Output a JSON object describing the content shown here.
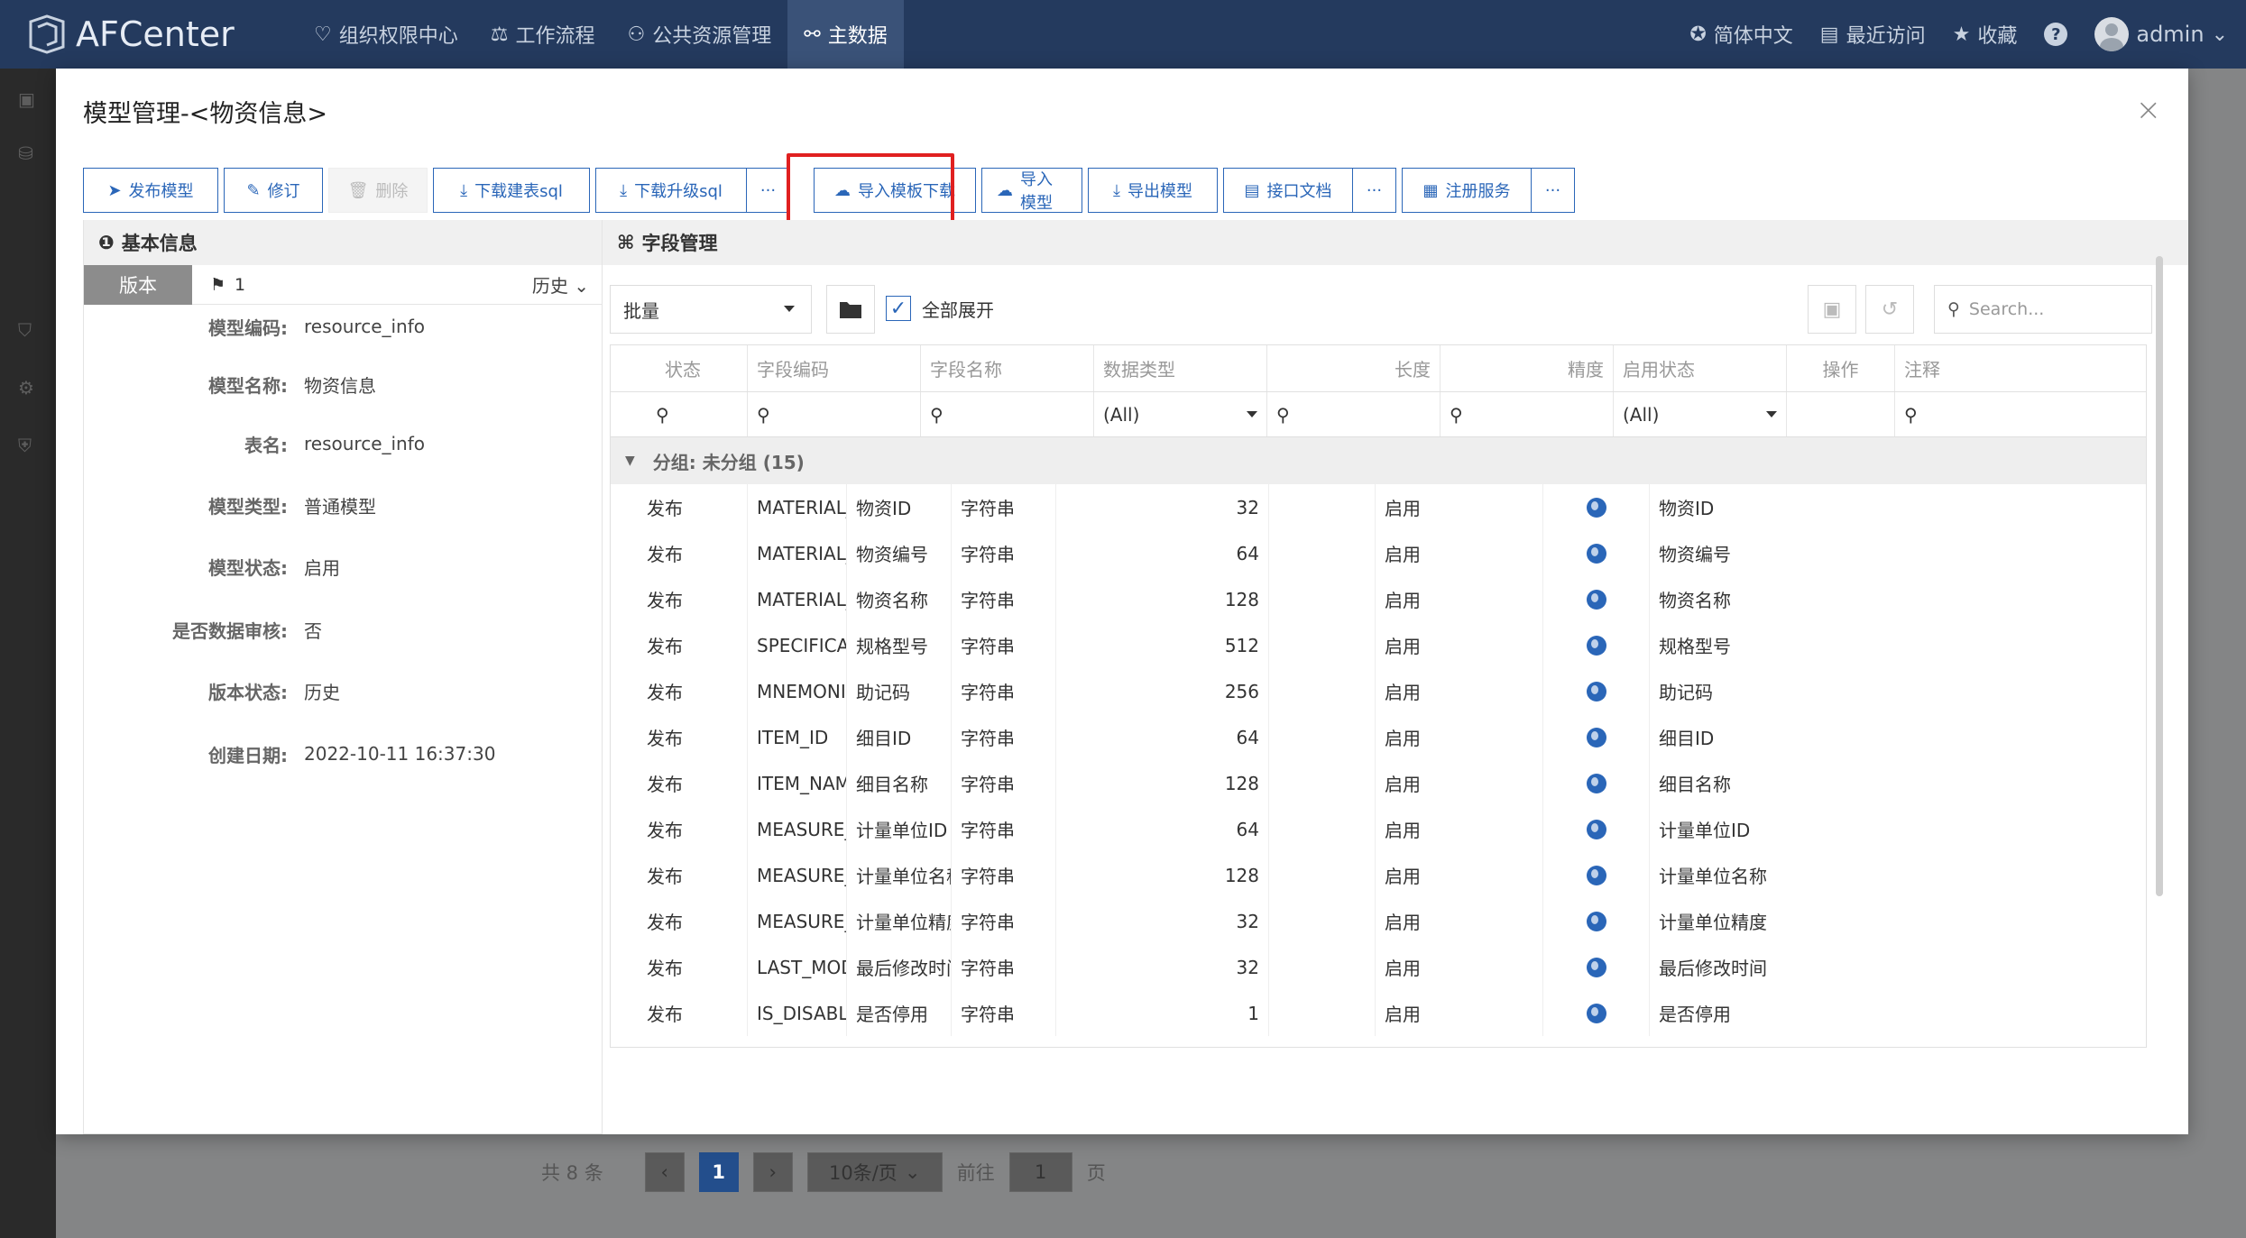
{
  "app": {
    "name": "AFCenter",
    "nav": [
      "组织权限中心",
      "工作流程",
      "公共资源管理",
      "主数据"
    ],
    "active_nav": 3,
    "lang": "简体中文",
    "recent": "最近访问",
    "fav": "收藏",
    "help": "?",
    "user": "admin"
  },
  "pager": {
    "total": "共 8 条",
    "page": "1",
    "size": "10条/页",
    "goto": "前往",
    "goto_val": "1",
    "page_unit": "页"
  },
  "modal": {
    "title": "模型管理-<物资信息>",
    "close": "×",
    "toolbar": [
      "发布模型",
      "修订",
      "删除",
      "下载建表sql",
      "下载升级sql",
      "导入模板下载",
      "导入模型",
      "导出模型",
      "接口文档",
      "注册服务"
    ],
    "more": "···",
    "left": {
      "header": "基本信息",
      "version_tab": "版本",
      "version_no": "1",
      "history": "历史",
      "fields": [
        {
          "k": "模型编码:",
          "v": "resource_info"
        },
        {
          "k": "模型名称:",
          "v": "物资信息"
        },
        {
          "k": "表名:",
          "v": "resource_info"
        },
        {
          "k": "模型类型:",
          "v": "普通模型"
        },
        {
          "k": "模型状态:",
          "v": "启用"
        },
        {
          "k": "是否数据审核:",
          "v": "否"
        },
        {
          "k": "版本状态:",
          "v": "历史"
        },
        {
          "k": "创建日期:",
          "v": "2022-10-11 16:37:30"
        }
      ]
    },
    "right": {
      "header": "字段管理",
      "batch": "批量",
      "expand_all": "全部展开",
      "search_placeholder": "Search...",
      "columns": [
        "状态",
        "字段编码",
        "字段名称",
        "数据类型",
        "长度",
        "精度",
        "启用状态",
        "操作",
        "注释"
      ],
      "filter_all": "(All)",
      "group": "分组: 未分组 (15)",
      "rows": [
        [
          "发布",
          "MATERIAL_ID",
          "物资ID",
          "字符串",
          "32",
          "",
          "启用",
          "物资ID"
        ],
        [
          "发布",
          "MATERIAL_CODE",
          "物资编号",
          "字符串",
          "64",
          "",
          "启用",
          "物资编号"
        ],
        [
          "发布",
          "MATERIAL_NA...",
          "物资名称",
          "字符串",
          "128",
          "",
          "启用",
          "物资名称"
        ],
        [
          "发布",
          "SPECIFICATION...",
          "规格型号",
          "字符串",
          "512",
          "",
          "启用",
          "规格型号"
        ],
        [
          "发布",
          "MNEMONIC_C...",
          "助记码",
          "字符串",
          "256",
          "",
          "启用",
          "助记码"
        ],
        [
          "发布",
          "ITEM_ID",
          "细目ID",
          "字符串",
          "64",
          "",
          "启用",
          "细目ID"
        ],
        [
          "发布",
          "ITEM_NAME",
          "细目名称",
          "字符串",
          "128",
          "",
          "启用",
          "细目名称"
        ],
        [
          "发布",
          "MEASURE_UNI...",
          "计量单位ID",
          "字符串",
          "64",
          "",
          "启用",
          "计量单位ID"
        ],
        [
          "发布",
          "MEASURE_UNI...",
          "计量单位名称",
          "字符串",
          "128",
          "",
          "启用",
          "计量单位名称"
        ],
        [
          "发布",
          "MEASURE_UNI...",
          "计量单位精度",
          "字符串",
          "32",
          "",
          "启用",
          "计量单位精度"
        ],
        [
          "发布",
          "LAST_MODIFY_...",
          "最后修改时间",
          "字符串",
          "32",
          "",
          "启用",
          "最后修改时间"
        ],
        [
          "发布",
          "IS_DISABLE",
          "是否停用",
          "字符串",
          "1",
          "",
          "启用",
          "是否停用"
        ]
      ]
    }
  },
  "colors": {
    "topbar": "#243a5e",
    "primary": "#2a66b8",
    "highlight": "#e02020"
  }
}
